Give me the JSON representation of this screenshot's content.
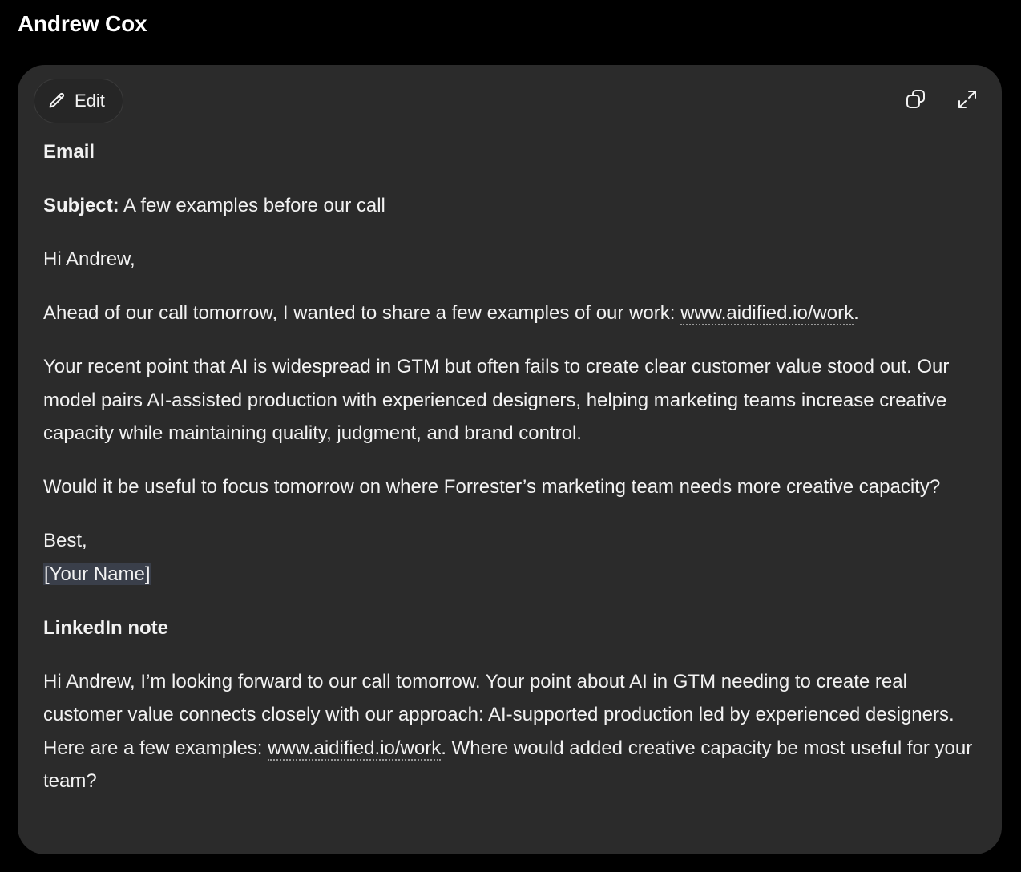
{
  "header": {
    "title": "Andrew Cox"
  },
  "toolbar": {
    "edit_label": "Edit",
    "edit_icon": "pencil-icon",
    "copy_icon": "copy-icon",
    "expand_icon": "expand-icon"
  },
  "email": {
    "heading": "Email",
    "subject_label": "Subject:",
    "subject_text": "A few examples before our call",
    "greeting": "Hi Andrew,",
    "para1_before": "Ahead of our call tomorrow, I wanted to share a few examples of our work: ",
    "para1_link": "www.aidified.io/work",
    "para1_after": ".",
    "para2": "Your recent point that AI is widespread in GTM but often fails to create clear customer value stood out. Our model pairs AI-assisted production with experienced designers, helping marketing teams increase creative capacity while maintaining quality, judgment, and brand control.",
    "para3": "Would it be useful to focus tomorrow on where Forrester’s marketing team needs more creative capacity?",
    "signoff": "Best,",
    "signature": "[Your Name]"
  },
  "linkedin": {
    "heading": "LinkedIn note",
    "text_before": "Hi Andrew, I’m looking forward to our call tomorrow. Your point about AI in GTM needing to create real customer value connects closely with our approach: AI-supported production led by experienced designers. Here are a few examples: ",
    "link": "www.aidified.io/work",
    "text_after": ". Where would added creative capacity be most useful for your team?"
  },
  "colors": {
    "background": "#000000",
    "card": "#2b2b2b",
    "text": "#f2f2f2",
    "placeholder_highlight": "#3a3f4a"
  }
}
